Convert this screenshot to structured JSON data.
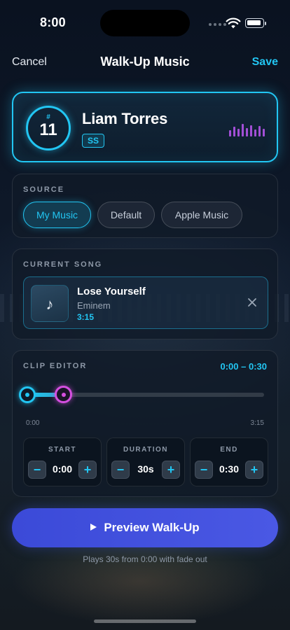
{
  "status_bar": {
    "time": "8:00"
  },
  "nav": {
    "cancel_label": "Cancel",
    "title": "Walk-Up Music",
    "save_label": "Save"
  },
  "player": {
    "number_prefix": "#",
    "number": "11",
    "name": "Liam Torres",
    "position": "SS"
  },
  "source": {
    "label": "SOURCE",
    "options": [
      {
        "label": "My Music",
        "selected": true
      },
      {
        "label": "Default",
        "selected": false
      },
      {
        "label": "Apple Music",
        "selected": false
      }
    ]
  },
  "current_song": {
    "label": "CURRENT SONG",
    "art_icon": "music-note-icon",
    "title": "Lose Yourself",
    "artist": "Eminem",
    "length": "3:15"
  },
  "clip_editor": {
    "label": "CLIP EDITOR",
    "range_text": "0:00 – 0:30",
    "timeline_start": "0:00",
    "timeline_end": "3:15",
    "clip_start_fraction": 0.0,
    "clip_end_fraction": 0.154,
    "start": {
      "label": "START",
      "value": "0:00"
    },
    "duration": {
      "label": "DURATION",
      "value": "30s"
    },
    "end": {
      "label": "END",
      "value": "0:30"
    },
    "minus_symbol": "−",
    "plus_symbol": "+"
  },
  "preview": {
    "button_label": "Preview Walk-Up",
    "note": "Plays 30s from 0:00 with fade out"
  },
  "colors": {
    "accent": "#22c6f3",
    "end_handle": "#d54fe0",
    "primary_button": "#3f4edc",
    "equalizer": "#a24fd6"
  }
}
